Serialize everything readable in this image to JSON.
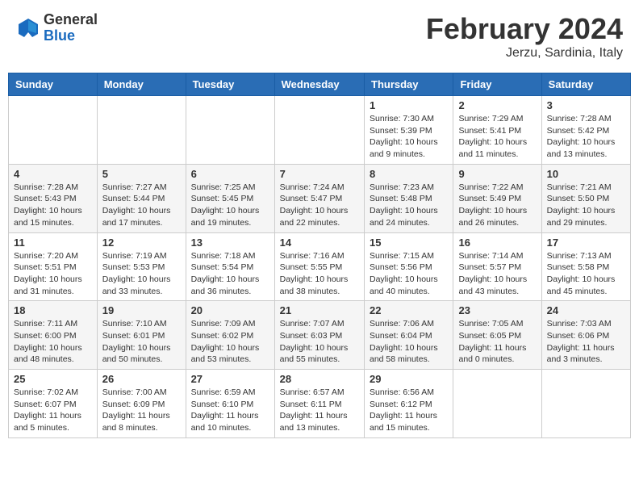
{
  "header": {
    "logo_general": "General",
    "logo_blue": "Blue",
    "month_title": "February 2024",
    "location": "Jerzu, Sardinia, Italy"
  },
  "weekdays": [
    "Sunday",
    "Monday",
    "Tuesday",
    "Wednesday",
    "Thursday",
    "Friday",
    "Saturday"
  ],
  "weeks": [
    [
      {
        "day": "",
        "info": ""
      },
      {
        "day": "",
        "info": ""
      },
      {
        "day": "",
        "info": ""
      },
      {
        "day": "",
        "info": ""
      },
      {
        "day": "1",
        "info": "Sunrise: 7:30 AM\nSunset: 5:39 PM\nDaylight: 10 hours\nand 9 minutes."
      },
      {
        "day": "2",
        "info": "Sunrise: 7:29 AM\nSunset: 5:41 PM\nDaylight: 10 hours\nand 11 minutes."
      },
      {
        "day": "3",
        "info": "Sunrise: 7:28 AM\nSunset: 5:42 PM\nDaylight: 10 hours\nand 13 minutes."
      }
    ],
    [
      {
        "day": "4",
        "info": "Sunrise: 7:28 AM\nSunset: 5:43 PM\nDaylight: 10 hours\nand 15 minutes."
      },
      {
        "day": "5",
        "info": "Sunrise: 7:27 AM\nSunset: 5:44 PM\nDaylight: 10 hours\nand 17 minutes."
      },
      {
        "day": "6",
        "info": "Sunrise: 7:25 AM\nSunset: 5:45 PM\nDaylight: 10 hours\nand 19 minutes."
      },
      {
        "day": "7",
        "info": "Sunrise: 7:24 AM\nSunset: 5:47 PM\nDaylight: 10 hours\nand 22 minutes."
      },
      {
        "day": "8",
        "info": "Sunrise: 7:23 AM\nSunset: 5:48 PM\nDaylight: 10 hours\nand 24 minutes."
      },
      {
        "day": "9",
        "info": "Sunrise: 7:22 AM\nSunset: 5:49 PM\nDaylight: 10 hours\nand 26 minutes."
      },
      {
        "day": "10",
        "info": "Sunrise: 7:21 AM\nSunset: 5:50 PM\nDaylight: 10 hours\nand 29 minutes."
      }
    ],
    [
      {
        "day": "11",
        "info": "Sunrise: 7:20 AM\nSunset: 5:51 PM\nDaylight: 10 hours\nand 31 minutes."
      },
      {
        "day": "12",
        "info": "Sunrise: 7:19 AM\nSunset: 5:53 PM\nDaylight: 10 hours\nand 33 minutes."
      },
      {
        "day": "13",
        "info": "Sunrise: 7:18 AM\nSunset: 5:54 PM\nDaylight: 10 hours\nand 36 minutes."
      },
      {
        "day": "14",
        "info": "Sunrise: 7:16 AM\nSunset: 5:55 PM\nDaylight: 10 hours\nand 38 minutes."
      },
      {
        "day": "15",
        "info": "Sunrise: 7:15 AM\nSunset: 5:56 PM\nDaylight: 10 hours\nand 40 minutes."
      },
      {
        "day": "16",
        "info": "Sunrise: 7:14 AM\nSunset: 5:57 PM\nDaylight: 10 hours\nand 43 minutes."
      },
      {
        "day": "17",
        "info": "Sunrise: 7:13 AM\nSunset: 5:58 PM\nDaylight: 10 hours\nand 45 minutes."
      }
    ],
    [
      {
        "day": "18",
        "info": "Sunrise: 7:11 AM\nSunset: 6:00 PM\nDaylight: 10 hours\nand 48 minutes."
      },
      {
        "day": "19",
        "info": "Sunrise: 7:10 AM\nSunset: 6:01 PM\nDaylight: 10 hours\nand 50 minutes."
      },
      {
        "day": "20",
        "info": "Sunrise: 7:09 AM\nSunset: 6:02 PM\nDaylight: 10 hours\nand 53 minutes."
      },
      {
        "day": "21",
        "info": "Sunrise: 7:07 AM\nSunset: 6:03 PM\nDaylight: 10 hours\nand 55 minutes."
      },
      {
        "day": "22",
        "info": "Sunrise: 7:06 AM\nSunset: 6:04 PM\nDaylight: 10 hours\nand 58 minutes."
      },
      {
        "day": "23",
        "info": "Sunrise: 7:05 AM\nSunset: 6:05 PM\nDaylight: 11 hours\nand 0 minutes."
      },
      {
        "day": "24",
        "info": "Sunrise: 7:03 AM\nSunset: 6:06 PM\nDaylight: 11 hours\nand 3 minutes."
      }
    ],
    [
      {
        "day": "25",
        "info": "Sunrise: 7:02 AM\nSunset: 6:07 PM\nDaylight: 11 hours\nand 5 minutes."
      },
      {
        "day": "26",
        "info": "Sunrise: 7:00 AM\nSunset: 6:09 PM\nDaylight: 11 hours\nand 8 minutes."
      },
      {
        "day": "27",
        "info": "Sunrise: 6:59 AM\nSunset: 6:10 PM\nDaylight: 11 hours\nand 10 minutes."
      },
      {
        "day": "28",
        "info": "Sunrise: 6:57 AM\nSunset: 6:11 PM\nDaylight: 11 hours\nand 13 minutes."
      },
      {
        "day": "29",
        "info": "Sunrise: 6:56 AM\nSunset: 6:12 PM\nDaylight: 11 hours\nand 15 minutes."
      },
      {
        "day": "",
        "info": ""
      },
      {
        "day": "",
        "info": ""
      }
    ]
  ]
}
